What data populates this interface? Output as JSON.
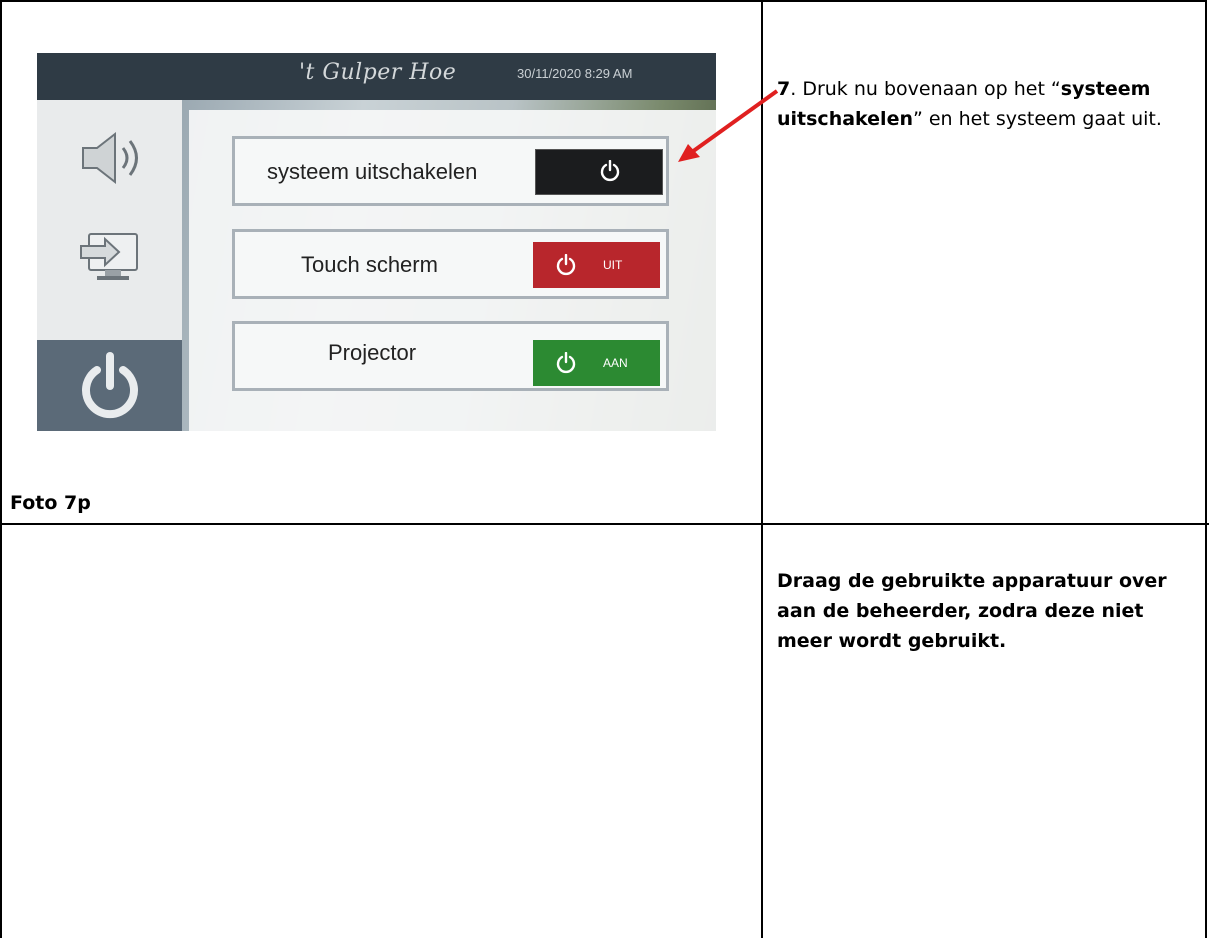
{
  "photo": {
    "brand": "'t Gulper Hoe",
    "datetime": "30/11/2020 8:29 AM",
    "sidebar": {
      "icons": [
        "speaker-icon",
        "input-source-icon",
        "power-icon"
      ]
    },
    "rows": [
      {
        "label": "systeem uitschakelen",
        "button_text": "",
        "button_color": "#1b1c1e"
      },
      {
        "label": "Touch scherm",
        "button_text": "UIT",
        "button_color": "#b8262c"
      },
      {
        "label": "Projector",
        "button_text": "AAN",
        "button_color": "#2c8a32"
      }
    ]
  },
  "caption": "Foto 7p",
  "instruction": {
    "number": "7",
    "text_before": ". Druk nu bovenaan op het “",
    "bold": "systeem uitschakelen",
    "text_after": "” en het systeem gaat uit."
  },
  "note": "Draag de gebruikte apparatuur over aan de beheerder, zodra deze niet meer wordt gebruikt.",
  "colors": {
    "arrow": "#e02020",
    "topbar": "#2f3b45",
    "sidebar_selected": "#5b6a78"
  }
}
